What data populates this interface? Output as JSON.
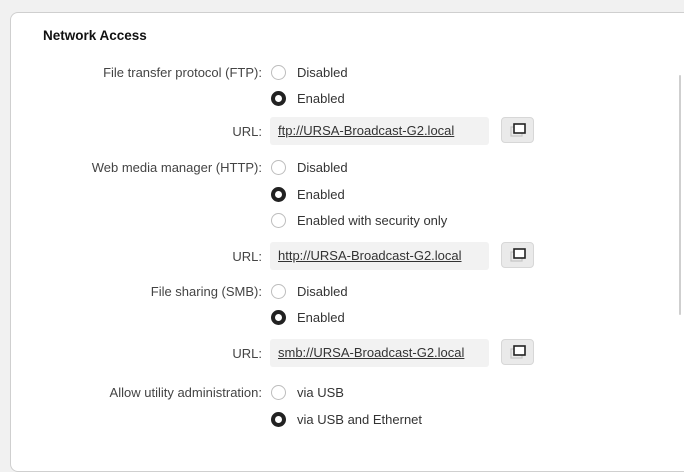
{
  "section": {
    "title": "Network Access"
  },
  "ftp": {
    "label": "File transfer protocol (FTP):",
    "options": [
      "Disabled",
      "Enabled"
    ],
    "selected": "Enabled",
    "url_label": "URL:",
    "url": "ftp://URSA-Broadcast-G2.local"
  },
  "http": {
    "label": "Web media manager (HTTP):",
    "options": [
      "Disabled",
      "Enabled",
      "Enabled with security only"
    ],
    "selected": "Enabled",
    "url_label": "URL:",
    "url": "http://URSA-Broadcast-G2.local"
  },
  "smb": {
    "label": "File sharing (SMB):",
    "options": [
      "Disabled",
      "Enabled"
    ],
    "selected": "Enabled",
    "url_label": "URL:",
    "url": "smb://URSA-Broadcast-G2.local"
  },
  "utility": {
    "label": "Allow utility administration:",
    "options": [
      "via USB",
      "via USB and Ethernet"
    ],
    "selected": "via USB and Ethernet"
  },
  "icons": {
    "copy": "copy-icon"
  }
}
